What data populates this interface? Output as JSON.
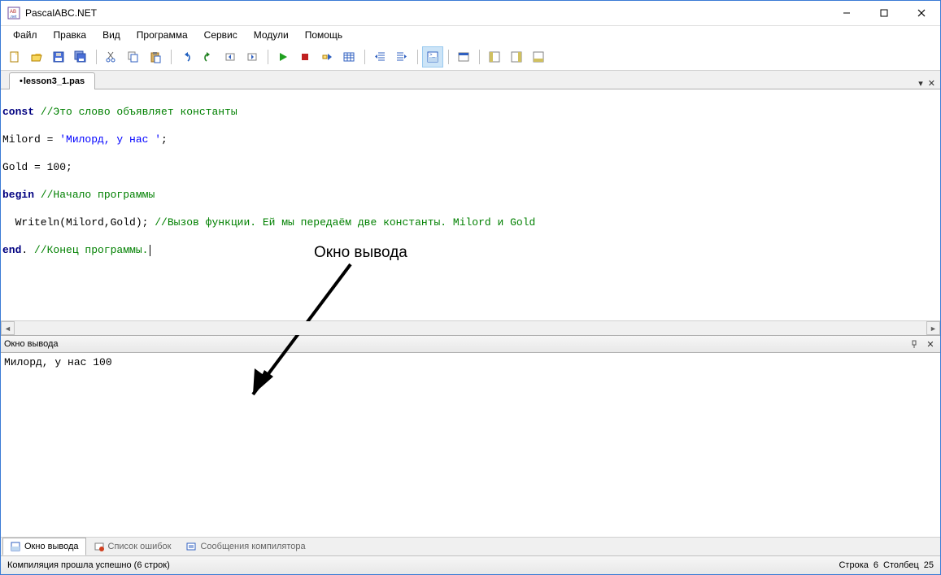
{
  "window": {
    "title": "PascalABC.NET"
  },
  "menu": {
    "items": [
      "Файл",
      "Правка",
      "Вид",
      "Программа",
      "Сервис",
      "Модули",
      "Помощь"
    ]
  },
  "toolbar_icons": [
    "new-file",
    "open-file",
    "save-file",
    "save-all",
    "sep",
    "cut",
    "copy",
    "paste",
    "sep",
    "undo",
    "redo",
    "nav-back",
    "nav-fwd",
    "sep",
    "run",
    "stop",
    "step-into",
    "compile",
    "sep",
    "outdent",
    "indent",
    "sep",
    "toggle-output",
    "sep",
    "form-designer",
    "sep",
    "props-1",
    "props-2",
    "props-3"
  ],
  "tab": {
    "dirty": "•",
    "name": "lesson3_1.pas"
  },
  "code": {
    "l1": {
      "kw": "const",
      "cm": " //Это слово объявляет константы"
    },
    "l2": {
      "a": "Milord = ",
      "str": "'Милорд, у нас '",
      "b": ";"
    },
    "l3": "Gold = 100;",
    "l4": {
      "kw": "begin",
      "cm": " //Начало программы"
    },
    "l5": {
      "a": "  Writeln(Milord,Gold); ",
      "cm": "//Вызов функции. Ей мы передаём две константы. Milord и Gold"
    },
    "l6": {
      "kw": "end",
      "a": ".",
      "cm": " //Конец программы."
    }
  },
  "annotation": "Окно вывода",
  "output_panel": {
    "title": "Окно вывода",
    "text": "Милорд, у нас 100"
  },
  "bottom_tabs": {
    "t1": "Окно вывода",
    "t2": "Список ошибок",
    "t3": "Сообщения компилятора"
  },
  "status": {
    "left": "Компиляция прошла успешно (6 строк)",
    "line_lbl": "Строка",
    "line": "6",
    "col_lbl": "Столбец",
    "col": "25"
  }
}
